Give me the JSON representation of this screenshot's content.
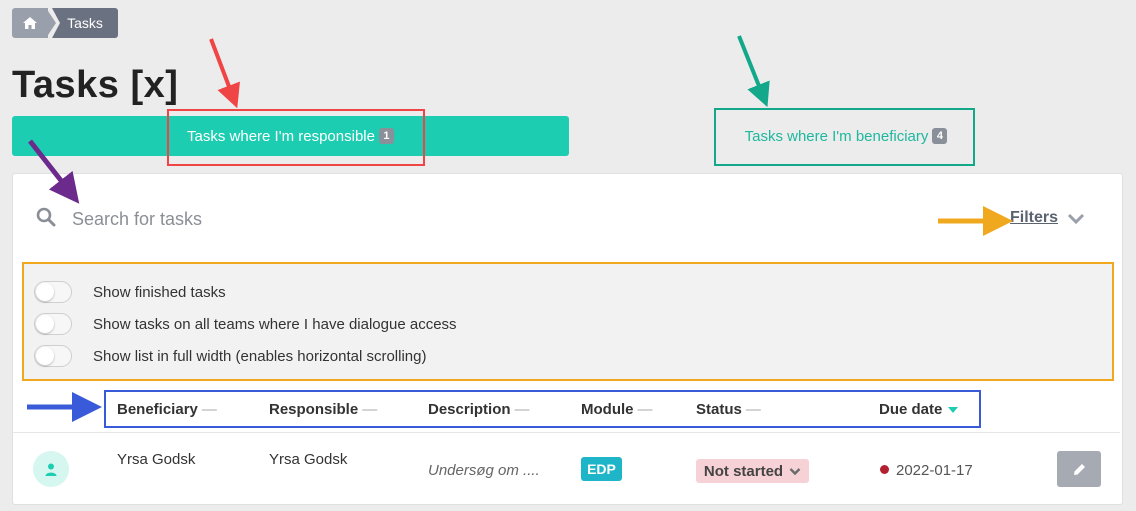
{
  "breadcrumb": {
    "home_icon": "home-icon",
    "current": "Tasks"
  },
  "page_title": "Tasks [x]",
  "tabs": [
    {
      "label": "Tasks where I'm responsible",
      "count": "1",
      "active": true
    },
    {
      "label": "Tasks where I'm beneficiary",
      "count": "4",
      "active": false
    }
  ],
  "search": {
    "placeholder": "Search for tasks",
    "icon": "search-icon"
  },
  "filters": {
    "label": "Filters",
    "icon": "chevron-down-icon"
  },
  "toggles": [
    {
      "label": "Show finished tasks",
      "on": false
    },
    {
      "label": "Show tasks on all teams where I have dialogue access",
      "on": false
    },
    {
      "label": "Show list in full width (enables horizontal scrolling)",
      "on": false
    }
  ],
  "columns": [
    "Beneficiary",
    "Responsible",
    "Description",
    "Module",
    "Status",
    "Due date"
  ],
  "column_dash": "—",
  "rows": [
    {
      "beneficiary": "Yrsa Godsk",
      "responsible": "Yrsa Godsk",
      "description": "Undersøg om ....",
      "module": "EDP",
      "status": "Not started",
      "due_date": "2022-01-17"
    }
  ],
  "colors": {
    "accent": "#1ccdb1",
    "module": "#1eb5c9",
    "status_bg": "#f6d2d6",
    "due_dot": "#b3202f",
    "annotation_red": "#ef4545",
    "annotation_green": "#12a889",
    "annotation_purple": "#6b2a8c",
    "annotation_orange": "#f0a81e",
    "annotation_blue": "#3a5bd9"
  }
}
